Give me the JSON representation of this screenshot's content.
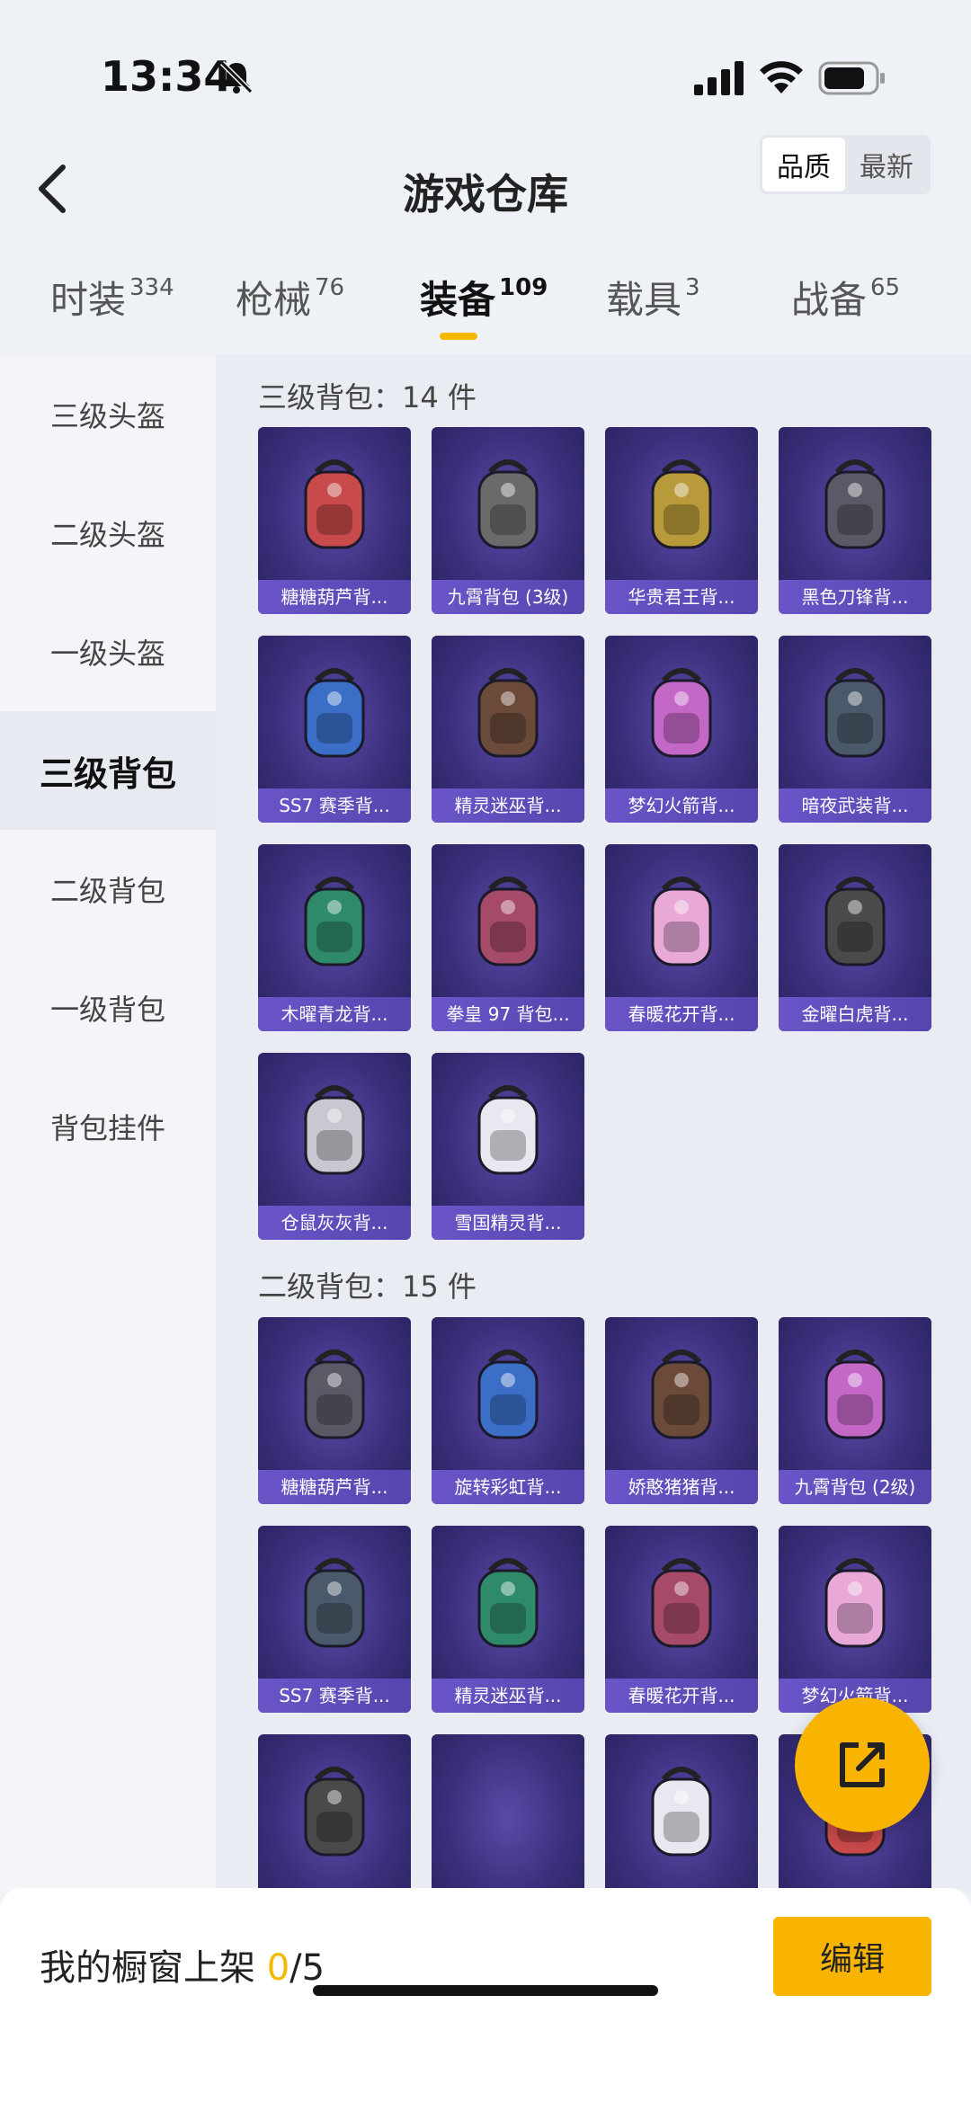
{
  "status": {
    "time": "13:34"
  },
  "header": {
    "title": "游戏仓库",
    "sort": [
      "品质",
      "最新"
    ]
  },
  "tabs": [
    {
      "label": "时装",
      "count": "334"
    },
    {
      "label": "枪械",
      "count": "76"
    },
    {
      "label": "装备",
      "count": "109"
    },
    {
      "label": "载具",
      "count": "3"
    },
    {
      "label": "战备",
      "count": "65"
    }
  ],
  "sidebar": [
    "三级头盔",
    "二级头盔",
    "一级头盔",
    "三级背包",
    "二级背包",
    "一级背包",
    "背包挂件"
  ],
  "sections": [
    {
      "title": "三级背包：14 件",
      "items": [
        "糖糖葫芦背...",
        "九霄背包 (3级)",
        "华贵君王背...",
        "黑色刀锋背...",
        "SS7 赛季背...",
        "精灵迷巫背...",
        "梦幻火箭背...",
        "暗夜武装背...",
        "木曜青龙背...",
        "拳皇 97 背包...",
        "春暖花开背...",
        "金曜白虎背...",
        "仓鼠灰灰背...",
        "雪国精灵背..."
      ]
    },
    {
      "title": "二级背包：15 件",
      "items": [
        "糖糖葫芦背...",
        "旋转彩虹背...",
        "娇憨猪猪背...",
        "九霄背包 (2级)",
        "SS7 赛季背...",
        "精灵迷巫背...",
        "春暖花开背...",
        "梦幻火箭背...",
        "",
        "",
        "",
        ""
      ]
    }
  ],
  "bottom": {
    "label": "我的橱窗上架",
    "count": "0",
    "total": "/5",
    "edit": "编辑"
  },
  "colors": {
    "accent": "#f5b800",
    "card": "#3b2f7c",
    "card_label": "#6b55c9"
  }
}
